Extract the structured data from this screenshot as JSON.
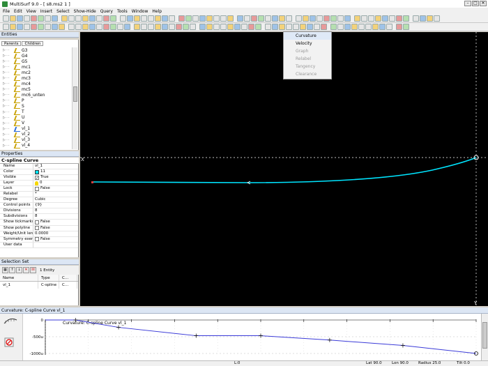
{
  "window": {
    "title": "MultiSurf 9.0 - [ s8.ms2 1 ]",
    "controls": [
      "–",
      "□",
      "✕"
    ]
  },
  "menu": [
    "File",
    "Edit",
    "View",
    "Insert",
    "Select",
    "Show-Hide",
    "Query",
    "Tools",
    "Window",
    "Help"
  ],
  "panels": {
    "entities": {
      "title": "Entities",
      "tabs": [
        "Parents",
        "Children"
      ],
      "items": [
        {
          "label": "G3",
          "kind": "point"
        },
        {
          "label": "G4",
          "kind": "point"
        },
        {
          "label": "G5",
          "kind": "point"
        },
        {
          "label": "mc1",
          "kind": "point"
        },
        {
          "label": "mc2",
          "kind": "point"
        },
        {
          "label": "mc3",
          "kind": "point"
        },
        {
          "label": "mc4",
          "kind": "point"
        },
        {
          "label": "mc5",
          "kind": "point"
        },
        {
          "label": "mc6_unten",
          "kind": "point"
        },
        {
          "label": "P",
          "kind": "point"
        },
        {
          "label": "S",
          "kind": "point"
        },
        {
          "label": "T",
          "kind": "point"
        },
        {
          "label": "U",
          "kind": "point"
        },
        {
          "label": "V",
          "kind": "point"
        },
        {
          "label": "vl_1",
          "kind": "curve"
        },
        {
          "label": "vl_2",
          "kind": "point"
        },
        {
          "label": "vl_3",
          "kind": "point"
        },
        {
          "label": "vl_4",
          "kind": "point"
        }
      ]
    },
    "properties": {
      "title": "Properties",
      "object_title": "C-spline Curve",
      "rows": [
        {
          "name": "Name",
          "value": "vl_1",
          "mark": ""
        },
        {
          "name": "Color",
          "value": "11",
          "mark": "swatch"
        },
        {
          "name": "Visible",
          "value": "True",
          "mark": "check"
        },
        {
          "name": "Layer",
          "value": "0",
          "mark": "bulb"
        },
        {
          "name": "Lock",
          "value": "False",
          "mark": "check"
        },
        {
          "name": "Relabel",
          "value": "*",
          "mark": ""
        },
        {
          "name": "Degree",
          "value": "Cubic",
          "mark": ""
        },
        {
          "name": "Control points",
          "value": "{9}",
          "mark": ""
        },
        {
          "name": "Divisions",
          "value": "8",
          "mark": ""
        },
        {
          "name": "Subdivisions",
          "value": "8",
          "mark": ""
        },
        {
          "name": "Show tickmarks",
          "value": "False",
          "mark": "check"
        },
        {
          "name": "Show polyline",
          "value": "False",
          "mark": "check"
        },
        {
          "name": "Weight/Unit length",
          "value": "0.0000",
          "mark": ""
        },
        {
          "name": "Symmetry exempt",
          "value": "False",
          "mark": "check"
        },
        {
          "name": "User data",
          "value": "",
          "mark": ""
        }
      ]
    },
    "selection_set": {
      "title": "Selection Set",
      "count_label": "1 Entity",
      "columns": [
        "Name",
        "Type",
        "C..."
      ],
      "rows": [
        {
          "name": "vl_1",
          "type": "C-spline",
          "c": "C..."
        }
      ]
    }
  },
  "viewport": {
    "axis_labels": {
      "x": "X",
      "y": "Y"
    },
    "curve_color": "#00e5ff"
  },
  "dropdown": {
    "items": [
      {
        "label": "Curvature",
        "enabled": true,
        "hover": true
      },
      {
        "label": "Velocity",
        "enabled": true,
        "hover": false
      },
      {
        "label": "Graph",
        "enabled": false,
        "hover": false
      },
      {
        "label": "Relabel",
        "enabled": false,
        "hover": false
      },
      {
        "label": "Tangency",
        "enabled": false,
        "hover": false
      },
      {
        "label": "Clearance",
        "enabled": false,
        "hover": false
      }
    ]
  },
  "curvature_panel": {
    "title": "Curvature: C-spline Curve vl_1",
    "inner_label": "Curvature: C-spline Curve vl_1",
    "y_ticks": [
      "0",
      "-500u",
      "-1000u"
    ]
  },
  "chart_data": {
    "type": "line",
    "title": "Curvature: C-spline Curve vl_1",
    "xlabel": "",
    "ylabel": "",
    "ylim": [
      -1000,
      0
    ],
    "x": [
      0,
      0.07,
      0.17,
      0.35,
      0.5,
      0.66,
      0.83,
      1.0
    ],
    "series": [
      {
        "name": "",
        "values": [
          0,
          0,
          -220,
          -470,
          -470,
          -600,
          -760,
          -1000
        ],
        "color": "#3a3ad8"
      }
    ]
  },
  "statusbar": {
    "layer": "L:0",
    "lat": "Lat 90.0",
    "lon": "Lon 90.0",
    "radius": "Radius 25.0",
    "tilt": "Tilt 0.0"
  }
}
